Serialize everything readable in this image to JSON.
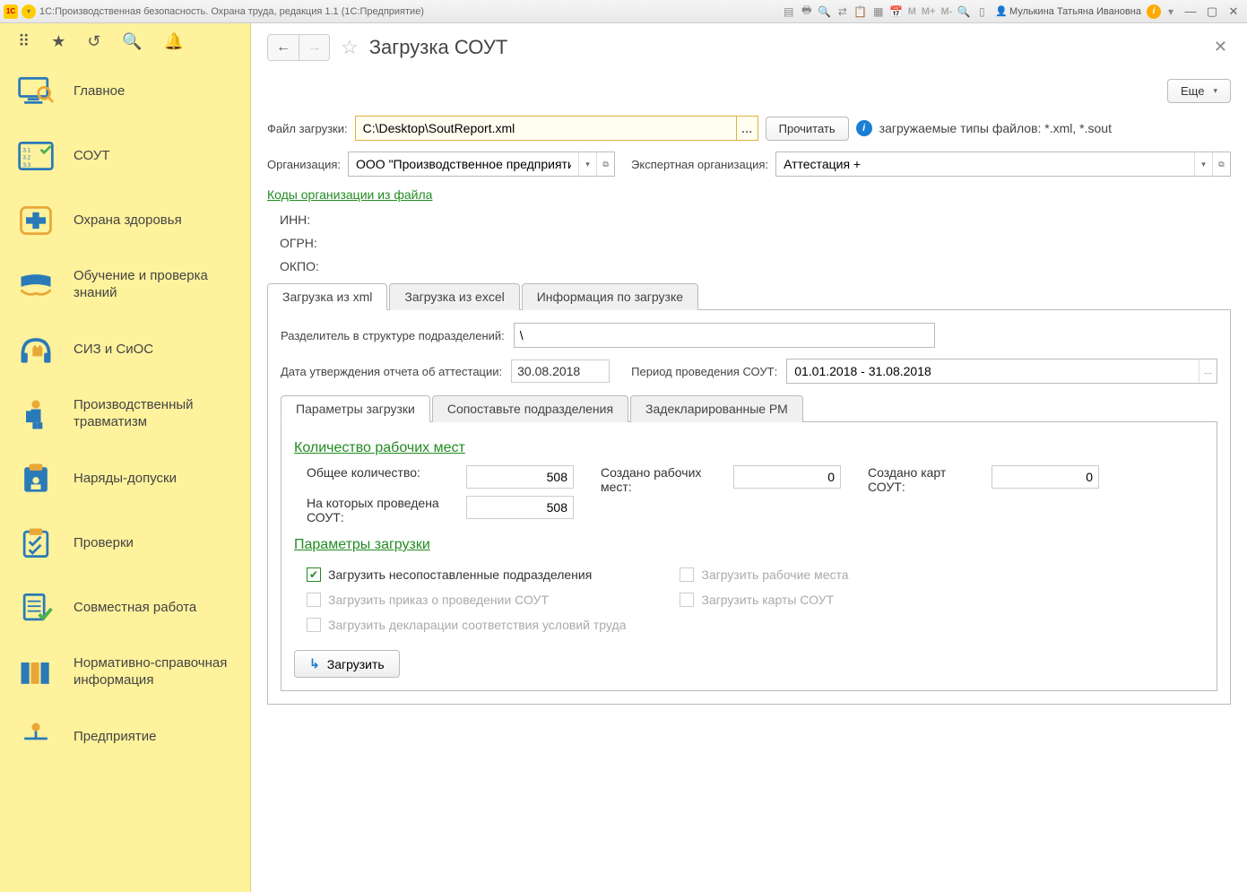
{
  "titlebar": {
    "text": "1С:Производственная безопасность. Охрана труда, редакция 1.1  (1С:Предприятие)",
    "user_prefix": "",
    "user": "Мулькина Татьяна Ивановна",
    "m_labels": [
      "M",
      "M+",
      "M-"
    ]
  },
  "sidebar": {
    "items": [
      {
        "id": "main",
        "label": "Главное"
      },
      {
        "id": "sout",
        "label": "СОУТ"
      },
      {
        "id": "health",
        "label": "Охрана здоровья"
      },
      {
        "id": "training",
        "label": "Обучение и проверка знаний"
      },
      {
        "id": "siz",
        "label": "СИЗ и СиОС"
      },
      {
        "id": "trauma",
        "label": "Производственный травматизм"
      },
      {
        "id": "permits",
        "label": "Наряды-допуски"
      },
      {
        "id": "checks",
        "label": "Проверки"
      },
      {
        "id": "collab",
        "label": "Совместная работа"
      },
      {
        "id": "nsi",
        "label": "Нормативно-справочная информация"
      },
      {
        "id": "enterprise",
        "label": "Предприятие"
      }
    ]
  },
  "header": {
    "title": "Загрузка СОУТ",
    "more": "Еще"
  },
  "file": {
    "label": "Файл загрузки:",
    "value": "C:\\Desktop\\SoutReport.xml",
    "read_btn": "Прочитать",
    "hint": "загружаемые типы файлов: *.xml, *.sout"
  },
  "org": {
    "label": "Организация:",
    "value": "ООО \"Производственное предприятие\"",
    "expert_label": "Экспертная организация:",
    "expert_value": "Аттестация +"
  },
  "codes": {
    "link": "Коды организации из файла",
    "inn": "ИНН:",
    "ogrn": "ОГРН:",
    "okpo": "ОКПО:"
  },
  "tabs1": {
    "items": [
      {
        "id": "xml",
        "label": "Загрузка из xml"
      },
      {
        "id": "excel",
        "label": "Загрузка из excel"
      },
      {
        "id": "info",
        "label": "Информация по загрузке"
      }
    ]
  },
  "xml": {
    "sep_label": "Разделитель в структуре подразделений:",
    "sep_value": "\\",
    "date_label": "Дата утверждения отчета об аттестации:",
    "date_value": "30.08.2018",
    "period_label": "Период проведения СОУТ:",
    "period_value": "01.01.2018 - 31.08.2018"
  },
  "tabs2": {
    "items": [
      {
        "id": "params",
        "label": "Параметры загрузки"
      },
      {
        "id": "match",
        "label": "Сопоставьте подразделения"
      },
      {
        "id": "declared",
        "label": "Задекларированные РМ"
      }
    ]
  },
  "counts": {
    "title": "Количество рабочих мест",
    "total_label": "Общее количество:",
    "total_value": "508",
    "sout_label": "На которых проведена СОУТ:",
    "sout_value": "508",
    "created_wp_label": "Создано рабочих мест:",
    "created_wp_value": "0",
    "created_cards_label": "Создано карт СОУТ:",
    "created_cards_value": "0"
  },
  "params": {
    "title": "Параметры загрузки",
    "c1": "Загрузить несопоставленные подразделения",
    "c2": "Загрузить приказ о проведении СОУТ",
    "c3": "Загрузить декларации соответствия условий труда",
    "c4": "Загрузить рабочие места",
    "c5": "Загрузить карты СОУТ",
    "load_btn": "Загрузить"
  }
}
